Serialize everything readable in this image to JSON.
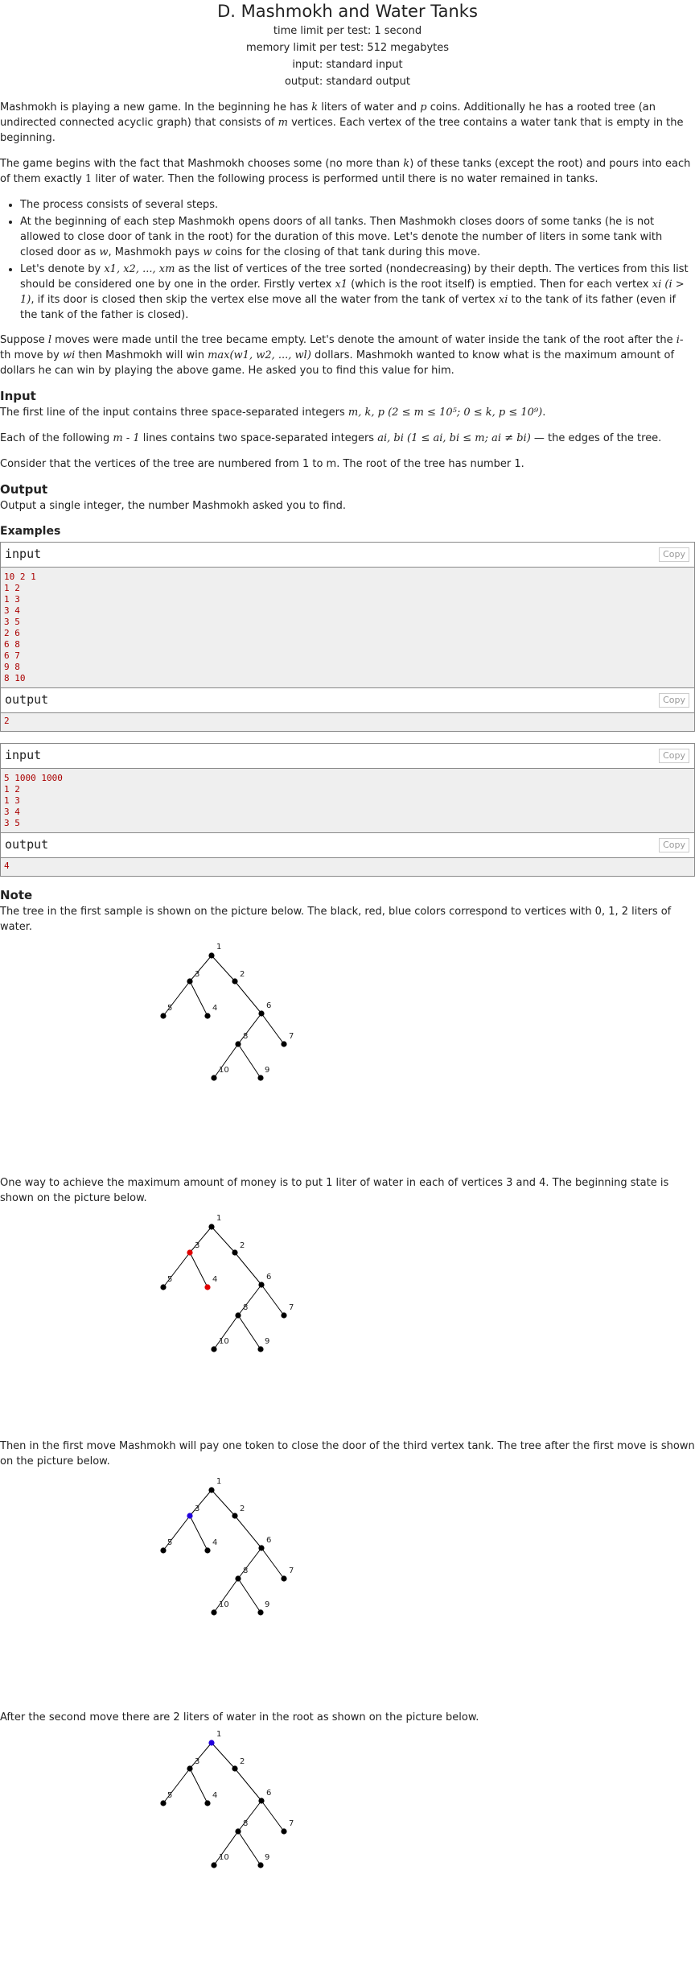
{
  "problem": {
    "title": "D. Mashmokh and Water Tanks",
    "time_limit": "time limit per test: 1 second",
    "memory_limit": "memory limit per test: 512 megabytes",
    "input_file": "input: standard input",
    "output_file": "output: standard output"
  },
  "statement": {
    "p1_a": "Mashmokh is playing a new game. In the beginning he has ",
    "p1_k": "k",
    "p1_b": " liters of water and ",
    "p1_p": "p",
    "p1_c": " coins. Additionally he has a rooted tree (an undirected connected acyclic graph) that consists of ",
    "p1_m": "m",
    "p1_d": " vertices. Each vertex of the tree contains a water tank that is empty in the beginning.",
    "p2_a": "The game begins with the fact that Mashmokh chooses some (no more than ",
    "p2_k": "k",
    "p2_b": ") of these tanks (except the root) and pours into each of them exactly ",
    "p2_one": "1",
    "p2_c": " liter of water. Then the following process is performed until there is no water remained in tanks.",
    "li1": "The process consists of several steps.",
    "li2_a": "At the beginning of each step Mashmokh opens doors of all tanks. Then Mashmokh closes doors of some tanks (he is not allowed to close door of tank in the root) for the duration of this move. Let's denote the number of liters in some tank with closed door as ",
    "li2_w": "w",
    "li2_b": ", Mashmokh pays ",
    "li2_w2": "w",
    "li2_c": " coins for the closing of that tank during this move.",
    "li3_a": "Let's denote by ",
    "li3_list": "x1, x2, ..., xm",
    "li3_b": " as the list of vertices of the tree sorted (nondecreasing) by their depth. The vertices from this list should be considered one by one in the order. Firstly vertex ",
    "li3_x1": "x1",
    "li3_c": " (which is the root itself) is emptied. Then for each vertex ",
    "li3_xi": "xi",
    "li3_cond": "(i > 1)",
    "li3_d": ", if its door is closed then skip the vertex else move all the water from the tank of vertex ",
    "li3_xi2": "xi",
    "li3_e": " to the tank of its father (even if the tank of the father is closed).",
    "p3_a": "Suppose ",
    "p3_l": "l",
    "p3_b": " moves were made until the tree became empty. Let's denote the amount of water inside the tank of the root after the ",
    "p3_i": "i",
    "p3_c": "-th move by ",
    "p3_wi": "wi",
    "p3_d": " then Mashmokh will win ",
    "p3_max": "max(w1, w2, ..., wl)",
    "p3_e": " dollars. Mashmokh wanted to know what is the maximum amount of dollars he can win by playing the above game. He asked you to find this value for him."
  },
  "input_section": {
    "title": "Input",
    "p1_a": "The first line of the input contains three space-separated integers ",
    "p1_vars": "m, k, p",
    "p1_cons": "(2 ≤ m ≤ 10⁵; 0 ≤ k, p ≤ 10⁹)",
    "p1_end": ".",
    "p2_a": "Each of the following ",
    "p2_m1": "m - 1",
    "p2_b": " lines contains two space-separated integers ",
    "p2_ab": "ai, bi",
    "p2_cons": "(1 ≤ ai, bi ≤ m; ai ≠ bi)",
    "p2_c": " — the edges of the tree.",
    "p3": "Consider that the vertices of the tree are numbered from 1 to m. The root of the tree has number 1."
  },
  "output_section": {
    "title": "Output",
    "p1": "Output a single integer, the number Mashmokh asked you to find."
  },
  "examples": {
    "title": "Examples",
    "input_label": "input",
    "output_label": "output",
    "copy_label": "Copy",
    "samples": [
      {
        "input": [
          "10 2 1",
          "1 2",
          "1 3",
          "3 4",
          "3 5",
          "2 6",
          "6 8",
          "6 7",
          "9 8",
          "8 10"
        ],
        "output": [
          "2"
        ]
      },
      {
        "input": [
          "5 1000 1000",
          "1 2",
          "1 3",
          "3 4",
          "3 5"
        ],
        "output": [
          "4"
        ]
      }
    ]
  },
  "note": {
    "title": "Note",
    "p1": "The tree in the first sample is shown on the picture below. The black, red, blue colors correspond to vertices with 0, 1, 2 liters of water.",
    "p2": "One way to achieve the maximum amount of money is to put 1 liter of water in each of vertices 3 and 4. The beginning state is shown on the picture below.",
    "p3": "Then in the first move Mashmokh will pay one token to close the door of the third vertex tank. The tree after the first move is shown on the picture below.",
    "p4": "After the second move there are 2 liters of water in the root as shown on the picture below."
  },
  "colors": {
    "black": "#000000",
    "red": "#e00000",
    "blue": "#2200dd",
    "sample_io_text": "#aa0000"
  },
  "tree_figures": [
    {
      "colored": {}
    },
    {
      "colored": {
        "3": "red",
        "4": "red"
      }
    },
    {
      "colored": {
        "3": "blue"
      }
    },
    {
      "colored": {
        "1": "blue"
      }
    }
  ],
  "tree_labels": [
    "1",
    "2",
    "3",
    "4",
    "5",
    "6",
    "7",
    "8",
    "9",
    "10"
  ]
}
